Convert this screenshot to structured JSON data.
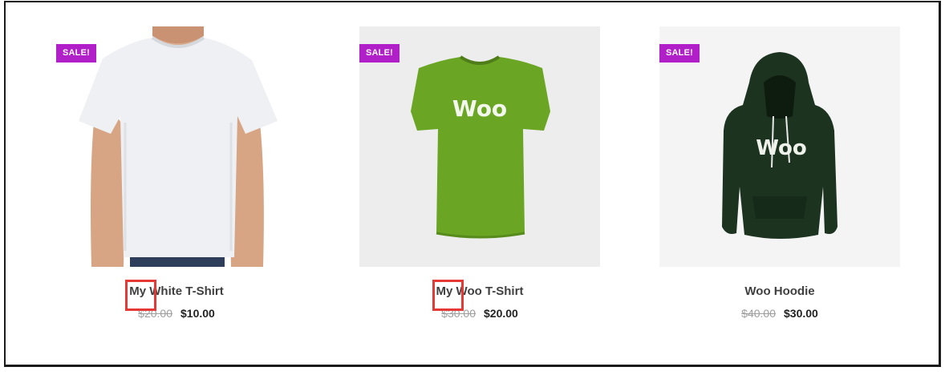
{
  "products": [
    {
      "badge": "SALE!",
      "title_prefix": "My",
      "title_rest": " White T-Shirt",
      "old_price": "$20.00",
      "new_price": "$10.00",
      "image": "white-tshirt-model"
    },
    {
      "badge": "SALE!",
      "title_prefix": "My",
      "title_rest": " Woo T-Shirt",
      "old_price": "$30.00",
      "new_price": "$20.00",
      "image": "green-woo-tshirt",
      "print": "Woo"
    },
    {
      "badge": "SALE!",
      "title": "Woo Hoodie",
      "old_price": "$40.00",
      "new_price": "$30.00",
      "image": "dark-green-woo-hoodie",
      "print": "Woo"
    }
  ],
  "colors": {
    "sale_badge": "#b01fc8",
    "highlight_box": "#e53935",
    "green_shirt": "#6aa524",
    "hoodie": "#1c3320"
  }
}
